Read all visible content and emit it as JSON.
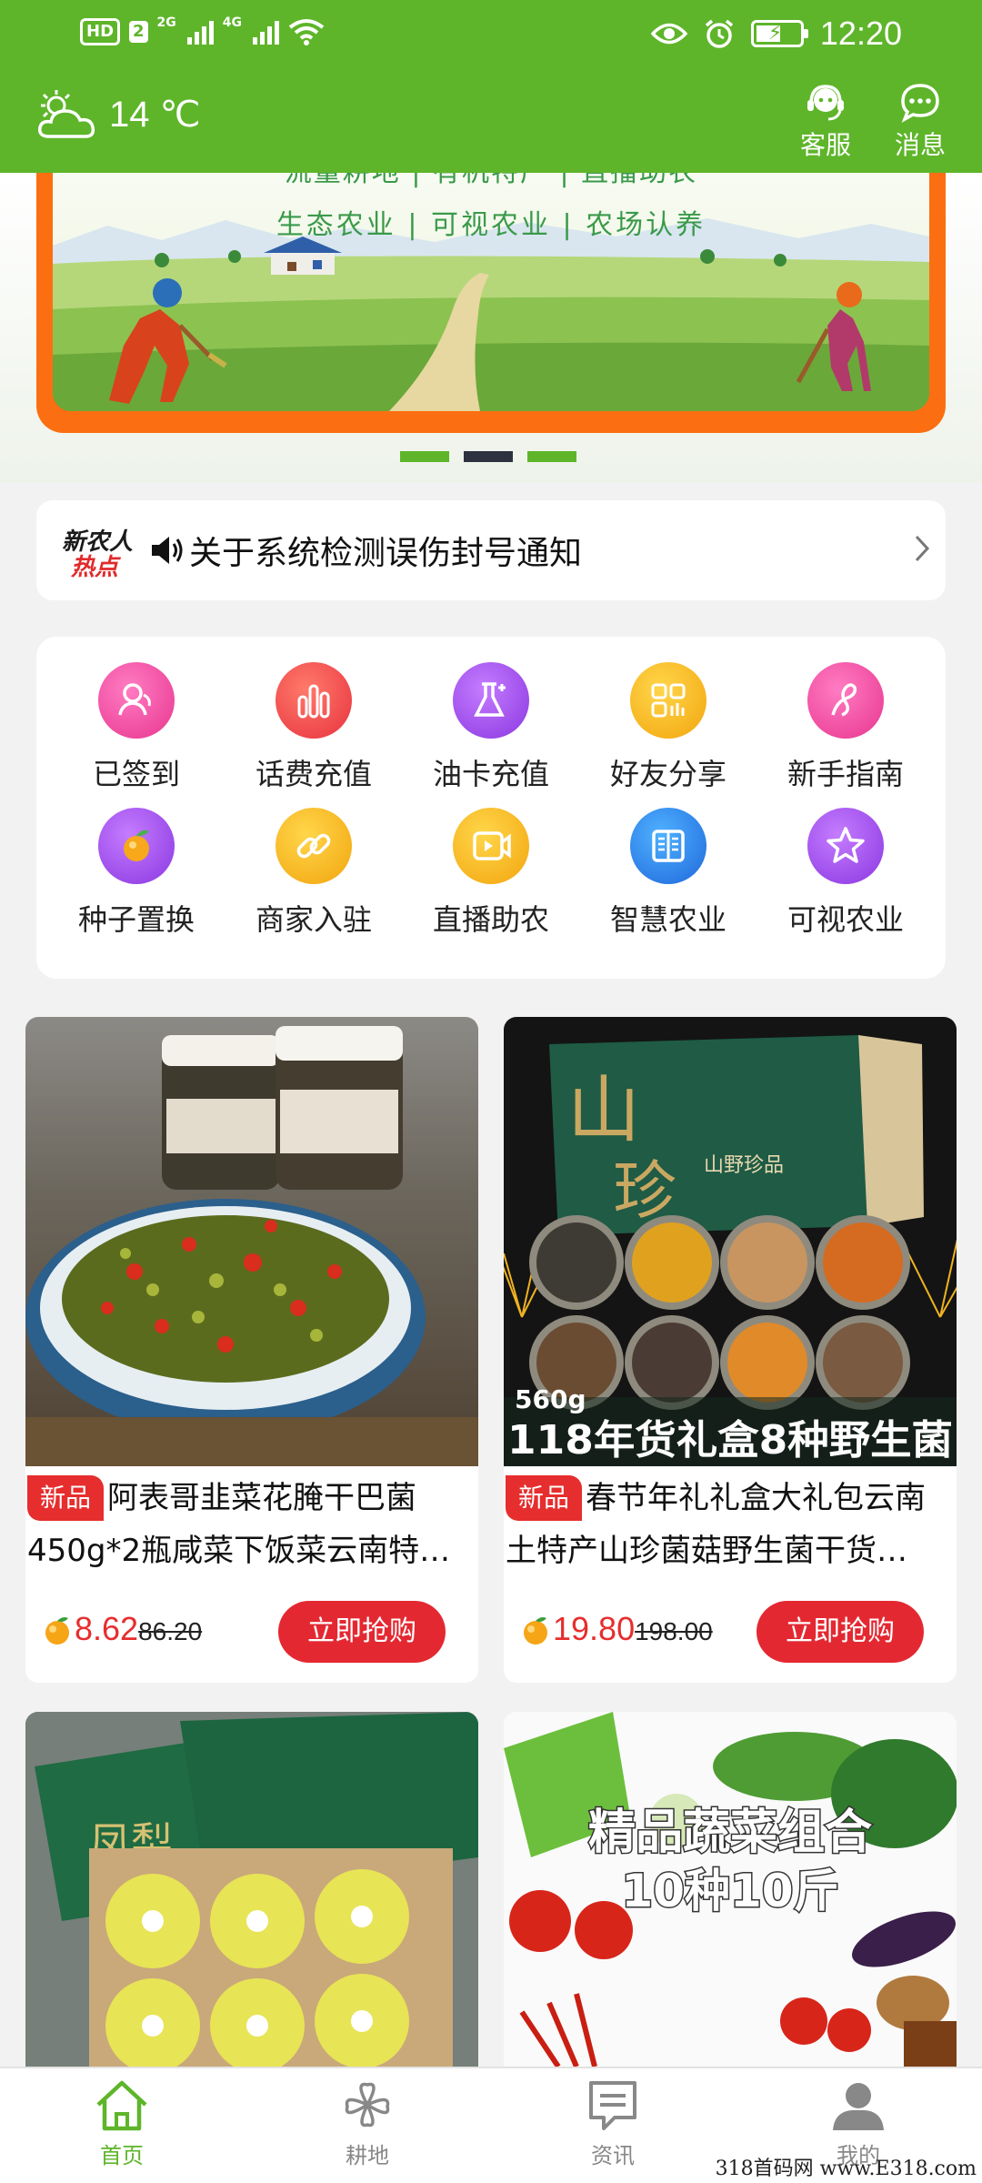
{
  "status_bar": {
    "hd": "HD",
    "sim": "2",
    "net1": "2G",
    "net2": "4G",
    "time": "12:20"
  },
  "header": {
    "weather_icon": "partly-cloudy-icon",
    "temperature": "14 ℃",
    "service_label": "客服",
    "message_label": "消息"
  },
  "banner": {
    "line1": "流量耕地 | 有机特产 | 直播助农",
    "line2": "生态农业 | 可视农业 | 农场认养",
    "indicator_count": 3,
    "active_index": 1
  },
  "notice": {
    "logo_line1": "新农人",
    "logo_line2": "热点",
    "text": "关于系统检测误伤封号通知"
  },
  "menu": [
    {
      "label": "已签到",
      "icon": "user-check-icon",
      "color": "#f0449a"
    },
    {
      "label": "话费充值",
      "icon": "bar-chart-icon",
      "color": "#f03a4c"
    },
    {
      "label": "油卡充值",
      "icon": "flask-icon",
      "color": "#9a3fe8"
    },
    {
      "label": "好友分享",
      "icon": "grid-share-icon",
      "color": "#f7b519"
    },
    {
      "label": "新手指南",
      "icon": "guide-icon",
      "color": "#f0449a"
    },
    {
      "label": "种子置换",
      "icon": "fruit-icon",
      "color": "#9a3fe8"
    },
    {
      "label": "商家入驻",
      "icon": "link-icon",
      "color": "#f7b519"
    },
    {
      "label": "直播助农",
      "icon": "video-icon",
      "color": "#f7b519"
    },
    {
      "label": "智慧农业",
      "icon": "book-icon",
      "color": "#2b7de8"
    },
    {
      "label": "可视农业",
      "icon": "star-icon",
      "color": "#9a3fe8"
    }
  ],
  "products": [
    {
      "tag": "新品",
      "title_line1": "阿表哥韭菜花腌干巴菌",
      "title_line2": "450g*2瓶咸菜下饭菜云南特…",
      "price": "8.62",
      "old_price": "86.20",
      "button": "立即抢购"
    },
    {
      "tag": "新品",
      "title_line1": "春节年礼礼盒大礼包云南",
      "title_line2": "土特产山珍菌菇野生菌干货…",
      "price": "19.80",
      "old_price": "198.00",
      "button": "立即抢购",
      "image_caption_small": "560g",
      "image_caption": "118年货礼盒8种野生菌",
      "box_text": "山野珍品"
    },
    {
      "box_text": "凤梨"
    },
    {
      "image_caption_line1": "精品蔬菜组合",
      "image_caption_line2": "10种10斤"
    }
  ],
  "bottom_nav": [
    {
      "label": "首页",
      "icon": "home-icon",
      "active": true
    },
    {
      "label": "耕地",
      "icon": "clover-icon",
      "active": false
    },
    {
      "label": "资讯",
      "icon": "news-icon",
      "active": false
    },
    {
      "label": "我的",
      "icon": "profile-icon",
      "active": false
    }
  ],
  "watermark": "318首码网 www.E318.com",
  "colors": {
    "brand_green": "#5eb52a",
    "price_red": "#e62e2e",
    "banner_orange": "#fb6f12"
  }
}
